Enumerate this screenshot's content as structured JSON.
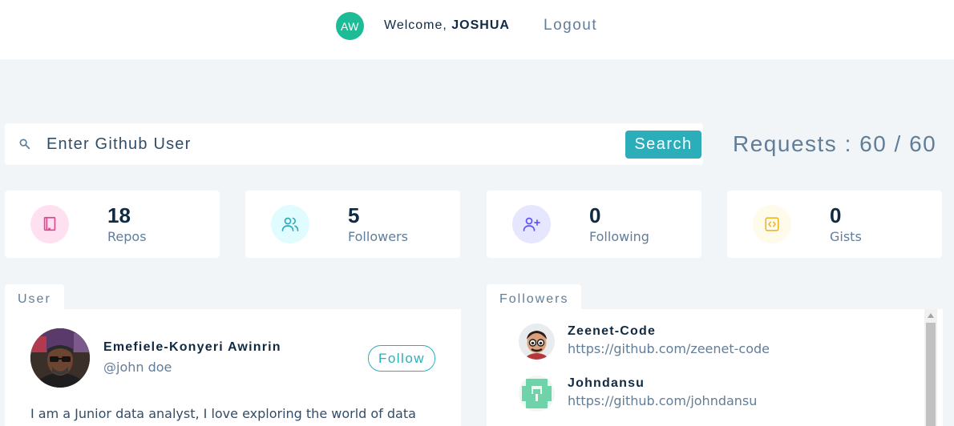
{
  "navbar": {
    "avatar_initials": "AW",
    "welcome_prefix": "Welcome, ",
    "username": "JOSHUA",
    "logout_label": "Logout"
  },
  "search": {
    "placeholder": "Enter Github User",
    "button_label": "Search",
    "requests_text": "Requests : 60 / 60"
  },
  "stats": [
    {
      "value": "18",
      "label": "Repos",
      "icon": "book-icon",
      "icon_color": "#da4a91",
      "bg_color": "#ffe0f0"
    },
    {
      "value": "5",
      "label": "Followers",
      "icon": "users-icon",
      "icon_color": "#2caeba",
      "bg_color": "#e0fcff"
    },
    {
      "value": "0",
      "label": "Following",
      "icon": "user-plus-icon",
      "icon_color": "#5d55fa",
      "bg_color": "#e6e6ff"
    },
    {
      "value": "0",
      "label": "Gists",
      "icon": "code-icon",
      "icon_color": "#f0b429",
      "bg_color": "#fffbea"
    }
  ],
  "user_card": {
    "tab_label": "User",
    "name": "Emefiele-Konyeri Awinrin",
    "handle": "@john doe",
    "follow_label": "Follow",
    "bio": "I am a Junior data analyst, I love exploring the world of data using"
  },
  "followers_card": {
    "tab_label": "Followers",
    "items": [
      {
        "name": "Zeenet-Code",
        "url": "https://github.com/zeenet-code"
      },
      {
        "name": "Johndansu",
        "url": "https://github.com/johndansu"
      }
    ]
  },
  "colors": {
    "accent": "#2caeba",
    "avatar_green": "#1ebc96",
    "background": "#f1f5f8"
  }
}
